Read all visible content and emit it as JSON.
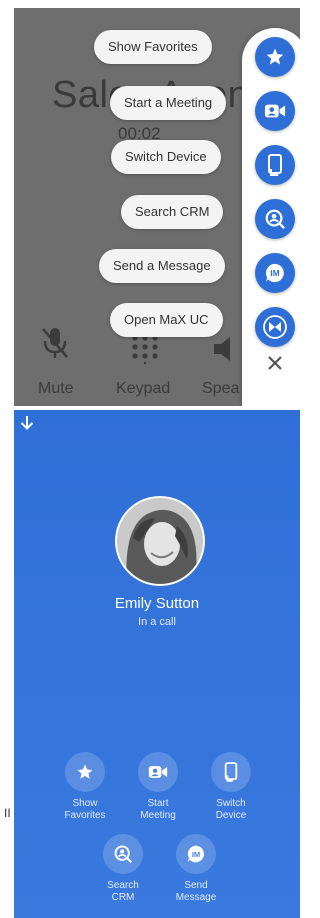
{
  "background_screen": {
    "title": "Sales Agent",
    "timer": "00:02",
    "controls": [
      {
        "label": "Mute",
        "icon": "mic-off-icon"
      },
      {
        "label": "Keypad",
        "icon": "dialpad-icon"
      },
      {
        "label": "Spea",
        "icon": "speaker-icon"
      }
    ]
  },
  "menu": {
    "items": [
      {
        "label": "Show Favorites",
        "icon": "star-icon"
      },
      {
        "label": "Start a Meeting",
        "icon": "video-meeting-icon"
      },
      {
        "label": "Switch Device",
        "icon": "switch-device-icon"
      },
      {
        "label": "Search CRM",
        "icon": "search-person-icon"
      },
      {
        "label": "Send a Message",
        "icon": "im-icon"
      },
      {
        "label": "Open MaX UC",
        "icon": "max-uc-logo-icon"
      }
    ],
    "close_icon": "close-icon"
  },
  "call": {
    "name": "Emily Sutton",
    "status": "In a call",
    "actions": [
      {
        "line1": "Show",
        "line2": "Favorites",
        "icon": "star-icon"
      },
      {
        "line1": "Start",
        "line2": "Meeting",
        "icon": "video-meeting-icon"
      },
      {
        "line1": "Switch",
        "line2": "Device",
        "icon": "switch-device-icon"
      },
      {
        "line1": "Search",
        "line2": "CRM",
        "icon": "search-person-icon"
      },
      {
        "line1": "Send",
        "line2": "Message",
        "icon": "im-icon"
      }
    ]
  },
  "side_mark": "II",
  "colors": {
    "accent": "#2d6fd6",
    "call_background": "#3474db",
    "overlay": "#6e6e6e"
  }
}
